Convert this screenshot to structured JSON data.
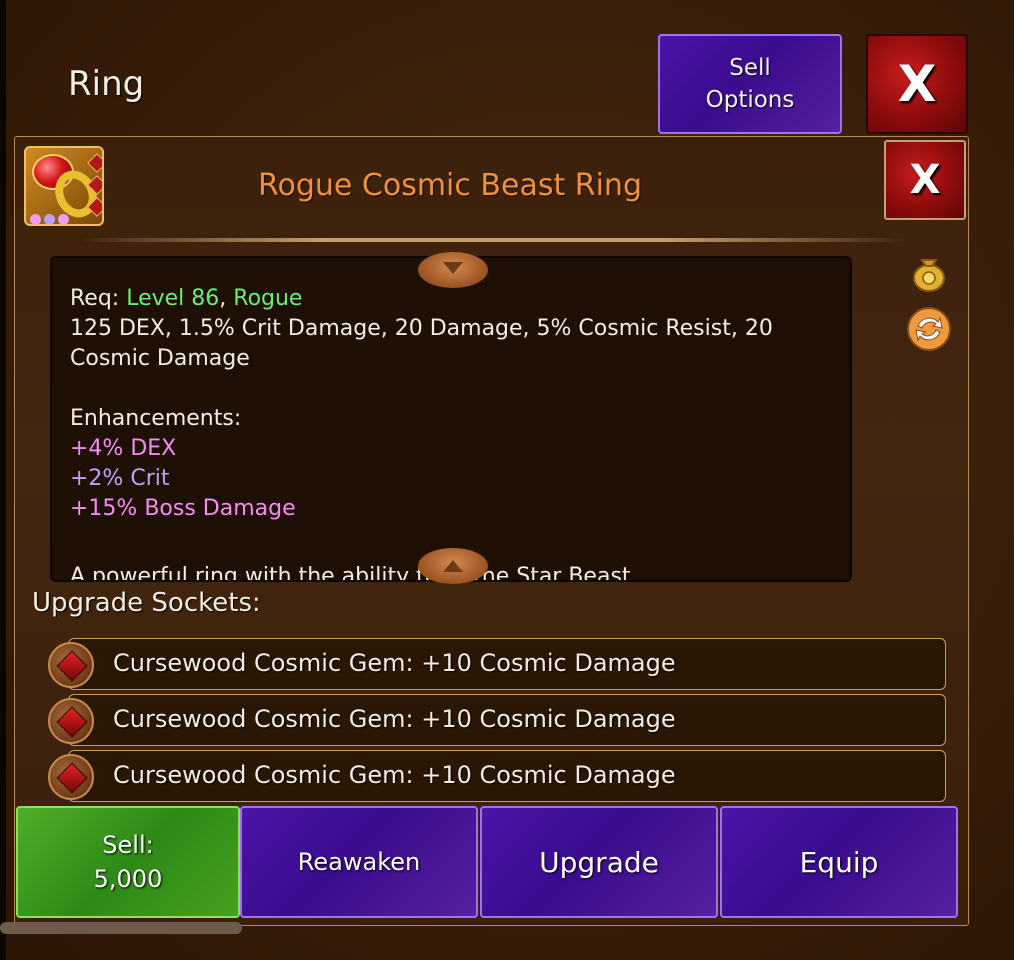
{
  "screen": {
    "title": "Ring"
  },
  "header": {
    "sell_options_label": "Sell Options",
    "close_label": "X"
  },
  "item": {
    "name": "Rogue Cosmic Beast Ring",
    "close_label": "X",
    "icon": "ring-icon",
    "requirements": {
      "prefix": "Req: ",
      "level": "Level 86",
      "separator": ", ",
      "class": "Rogue"
    },
    "stats_line_1": "125 DEX, 1.5% Crit Damage, 20 Damage, 5% Cosmic Resist, 20",
    "stats_line_2": "Cosmic Damage",
    "enhancements_title": "Enhancements:",
    "enhancements": [
      {
        "text": "+4% DEX",
        "color": "#f48cf4"
      },
      {
        "text": "+2% Crit",
        "color": "#b8a4f4"
      },
      {
        "text": "+15% Boss Damage",
        "color": "#f48cf4"
      }
    ],
    "flavor_partial": "A powerful ring with the ability to ... the Star Beast ..."
  },
  "side_icons": [
    "gold-bag-icon",
    "swap-icon"
  ],
  "sockets": {
    "title": "Upgrade Sockets:",
    "items": [
      {
        "text": "Cursewood Cosmic Gem: +10 Cosmic Damage",
        "icon": "red-gem-icon"
      },
      {
        "text": "Cursewood Cosmic Gem: +10 Cosmic Damage",
        "icon": "red-gem-icon"
      },
      {
        "text": "Cursewood Cosmic Gem: +10 Cosmic Damage",
        "icon": "red-gem-icon"
      }
    ]
  },
  "actions": {
    "sell_label": "Sell:",
    "sell_price": "5,000",
    "reawaken_label": "Reawaken",
    "upgrade_label": "Upgrade",
    "equip_label": "Equip"
  },
  "colors": {
    "item_name": "#f0903a",
    "requirement": "#6cf06c",
    "sell_button": "#3a9a1e",
    "purple_button": "#3f0f96",
    "close_button": "#a81414"
  }
}
